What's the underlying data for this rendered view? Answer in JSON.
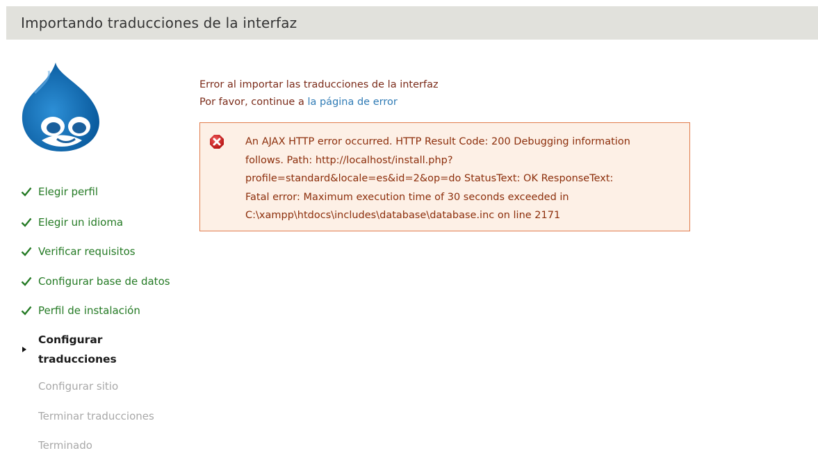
{
  "page": {
    "title": "Importando traducciones de la interfaz"
  },
  "steps": [
    {
      "label": "Elegir perfil",
      "state": "done"
    },
    {
      "label": "Elegir un idioma",
      "state": "done"
    },
    {
      "label": "Verificar requisitos",
      "state": "done"
    },
    {
      "label": "Configurar base de datos",
      "state": "done"
    },
    {
      "label": "Perfil de instalación",
      "state": "done"
    },
    {
      "label_line1": "Configurar",
      "label_line2": "traducciones",
      "state": "active"
    },
    {
      "label": "Configurar sitio",
      "state": "pending"
    },
    {
      "label": "Terminar traducciones",
      "state": "pending"
    },
    {
      "label": "Terminado",
      "state": "pending"
    }
  ],
  "main": {
    "error_title": "Error al importar las traducciones de la interfaz",
    "continue_prefix": "Por favor, continue a",
    "continue_link": "la página de error",
    "error_lines": [
      "An AJAX HTTP error occurred. HTTP Result Code: 200 Debugging information",
      "follows. Path: http://localhost/install.php?",
      "profile=standard&locale=es&id=2&op=do StatusText: OK ResponseText:",
      "Fatal error: Maximum execution time of 30 seconds exceeded in",
      "C:\\xampp\\htdocs\\includes\\database\\database.inc on line 2171"
    ]
  },
  "colors": {
    "header_bg": "#e1e1dc",
    "done": "#247a24",
    "pending": "#a8a8a8",
    "error_text": "#8c2e0b",
    "error_border": "#e07b4b",
    "error_bg": "#fdf0e6",
    "link": "#2f7bb5",
    "logo_blue": "#1f6fb5"
  }
}
